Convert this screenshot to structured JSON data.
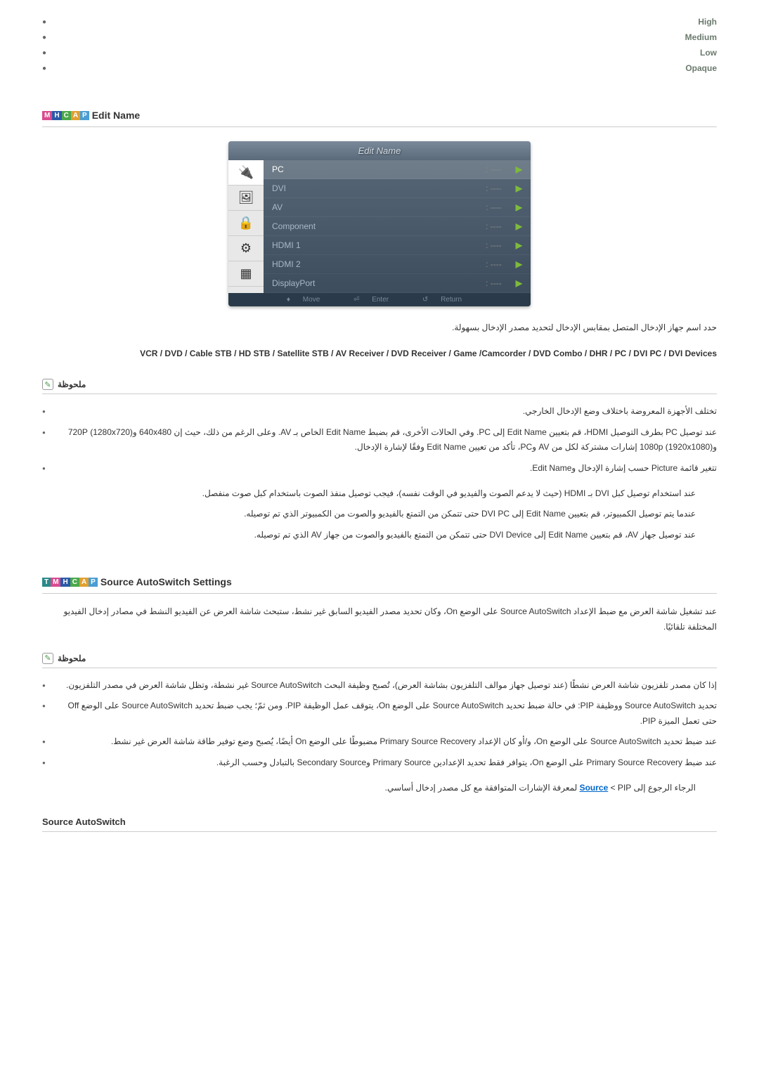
{
  "top_list": [
    "High",
    "Medium",
    "Low",
    "Opaque"
  ],
  "edit_name": {
    "tags": [
      "M",
      "H",
      "C",
      "A",
      "P"
    ],
    "title": "Edit Name",
    "menu": {
      "title": "Edit Name",
      "rows": [
        {
          "label": "PC",
          "value": ": ----",
          "selected": true
        },
        {
          "label": "DVI",
          "value": ": ----"
        },
        {
          "label": "AV",
          "value": ": ----"
        },
        {
          "label": "Component",
          "value": ": ----"
        },
        {
          "label": "HDMI 1",
          "value": ": ----"
        },
        {
          "label": "HDMI 2",
          "value": ": ----"
        },
        {
          "label": "DisplayPort",
          "value": ": ----"
        }
      ],
      "footer": {
        "move": "Move",
        "enter": "Enter",
        "return": "Return"
      }
    },
    "desc": "حدد اسم جهاز الإدخال المتصل بمقابس الإدخال لتحديد مصدر الإدخال بسهولة.",
    "sources": "VCR / DVD / Cable STB / HD STB / Satellite STB / AV Receiver / DVD Receiver / Game /Camcorder / DVD Combo / DHR / PC / DVI PC / DVI Devices",
    "note_title": "ملحوظة",
    "notes": [
      "تختلف الأجهزة المعروضة باختلاف وضع الإدخال الخارجي.",
      "عند توصيل PC بطرف التوصيل HDMI، قم بتعيين Edit Name إلى PC. وفي الحالات الأخرى، قم بضبط Edit Name الخاص بـ AV. وعلى الرغم من ذلك، حيث إن 640x480 و(1280x720) 720P و(1920x1080) 1080p إشارات مشتركة لكل من AV وPC، تأكد من تعيين Edit Name وفقًا لإشارة الإدخال.",
      "تتغير قائمة Picture حسب إشارة الإدخال وEdit Name."
    ],
    "sub_texts": [
      "عند استخدام توصيل كبل DVI بـ HDMI (حيث لا يدعم الصوت والفيديو في الوقت نفسه)، فيجب توصيل منفذ الصوت باستخدام كبل صوت منفصل.",
      "عندما يتم توصيل الكمبيوتر، قم بتعيين Edit Name إلى DVI PC حتى تتمكن من التمتع بالفيديو والصوت من الكمبيوتر الذي تم توصيله.",
      "عند توصيل جهاز AV، قم بتعيين Edit Name إلى DVI Device حتى تتمكن من التمتع بالفيديو والصوت من جهاز AV الذي تم توصيله."
    ]
  },
  "autoswitch": {
    "tags": [
      "T",
      "M",
      "H",
      "C",
      "A",
      "P"
    ],
    "title": "Source AutoSwitch Settings",
    "intro": "عند تشغيل شاشة العرض مع ضبط الإعداد Source AutoSwitch على الوضع On، وكان تحديد مصدر الفيديو السابق غير نشط، ستبحث شاشة العرض عن الفيديو النشط في مصادر إدخال الفيديو المختلفة تلقائيًا.",
    "note_title": "ملحوظة",
    "notes": [
      "إذا كان مصدر تلفزيون شاشة العرض نشطًا (عند توصيل جهاز موالف التلفزيون بشاشة العرض)، تُصبح وظيفة البحث Source AutoSwitch غير نشطة، وتظل شاشة العرض في مصدر التلفزيون.",
      "تحديد Source AutoSwitch ووظيفة PIP: في حالة ضبط تحديد Source AutoSwitch على الوضع On، يتوقف عمل الوظيفة PIP. ومن ثمّ؛ يجب ضبط تحديد Source AutoSwitch على الوضع Off حتى تعمل الميزة PIP.",
      "عند ضبط تحديد Source AutoSwitch على الوضع On، و/أو كان الإعداد Primary Source Recovery مضبوطًا على الوضع On أيضًا، يُصبح وضع توفير طاقة شاشة العرض غير نشط.",
      "عند ضبط Primary Source Recovery على الوضع On، يتوافر فقط تحديد الإعدادين Primary Source وSecondary Source بالتبادل وحسب الرغبة."
    ],
    "ref_text_pre": "الرجاء الرجوع إلى ",
    "ref_link": "Source",
    "ref_text_post": " < PIP لمعرفة الإشارات المتوافقة مع كل مصدر إدخال أساسي."
  },
  "footer_title": "Source AutoSwitch"
}
